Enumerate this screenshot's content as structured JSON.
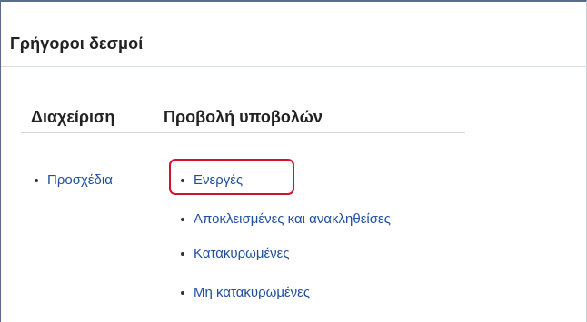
{
  "panel": {
    "title": "Γρήγοροι δεσμοί"
  },
  "columns": {
    "manage": {
      "heading": "Διαχείριση",
      "items": [
        {
          "label": "Προσχέδια"
        }
      ]
    },
    "view": {
      "heading": "Προβολή υποβολών",
      "items": [
        {
          "label": "Ενεργές",
          "highlighted": true
        },
        {
          "label": "Αποκλεισμένες και ανακληθείσες"
        },
        {
          "label": "Κατακυρωμένες"
        },
        {
          "label": "Μη κατακυρωμένες"
        }
      ]
    }
  },
  "colors": {
    "link": "#1f4e9c",
    "highlight_border": "#d6122b",
    "heading": "#222222"
  }
}
